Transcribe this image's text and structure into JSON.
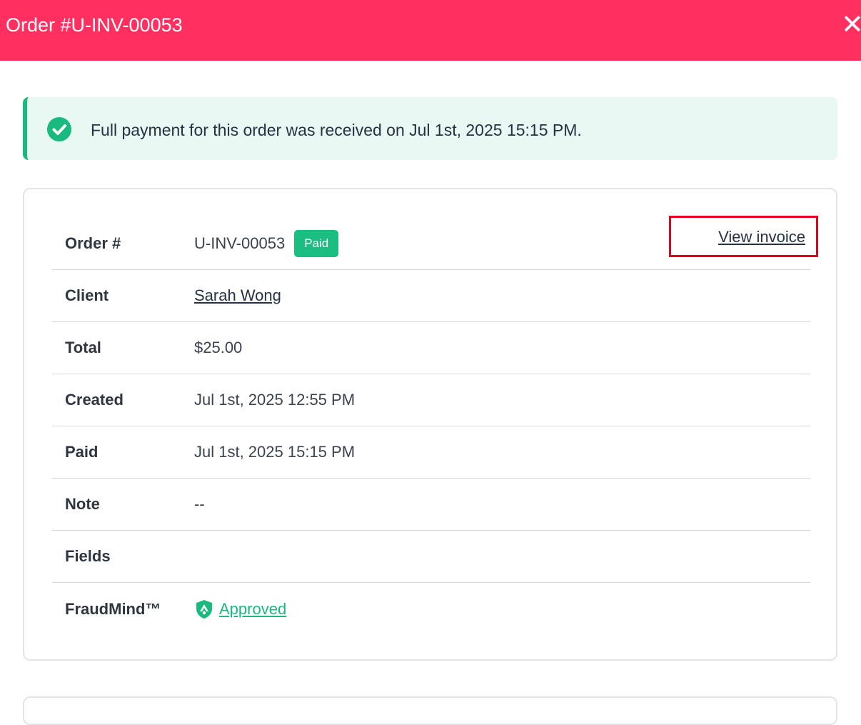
{
  "header": {
    "title": "Order #U-INV-00053",
    "close_icon": "close-icon"
  },
  "alert": {
    "icon": "check-circle-icon",
    "text": "Full payment for this order was received on Jul 1st, 2025 15:15 PM."
  },
  "order": {
    "rows": {
      "order": {
        "label": "Order #",
        "value": "U-INV-00053",
        "badge": "Paid",
        "action": "View invoice"
      },
      "client": {
        "label": "Client",
        "value": "Sarah Wong"
      },
      "total": {
        "label": "Total",
        "value": "$25.00"
      },
      "created": {
        "label": "Created",
        "value": "Jul 1st, 2025 12:55 PM"
      },
      "paid": {
        "label": "Paid",
        "value": "Jul 1st, 2025 15:15 PM"
      },
      "note": {
        "label": "Note",
        "value": "--"
      },
      "fields": {
        "label": "Fields",
        "value": ""
      },
      "fraudmind": {
        "label": "FraudMind™",
        "value": "Approved",
        "icon": "shield-icon"
      }
    }
  },
  "colors": {
    "header_bg": "#ff3060",
    "success": "#1ab97d",
    "alert_bg": "#e8f8f2",
    "highlight": "#e8001a"
  }
}
